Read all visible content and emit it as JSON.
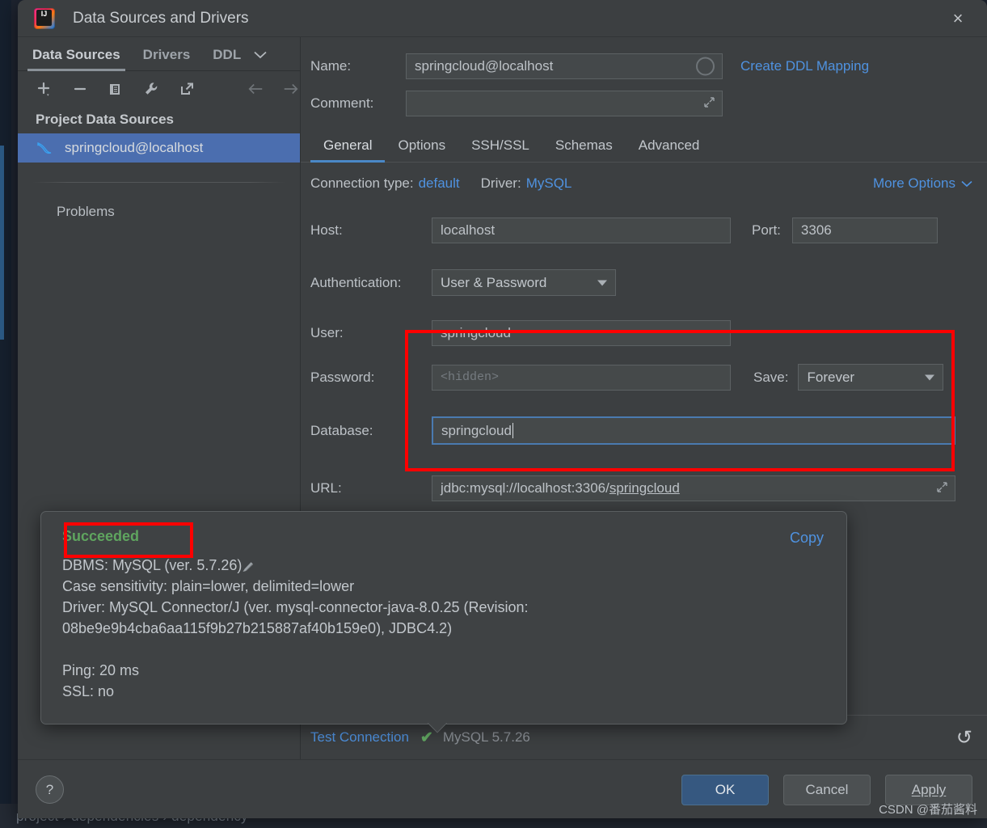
{
  "background": {
    "breadcrumb": "project  ›  dependencies  ›  dependency"
  },
  "window": {
    "title": "Data Sources and Drivers",
    "logo_text": "IJ",
    "close_icon": "×"
  },
  "left_pane": {
    "tabs": [
      {
        "label": "Data Sources",
        "active": true
      },
      {
        "label": "Drivers",
        "active": false
      },
      {
        "label": "DDL",
        "active": false
      }
    ],
    "tabs_overflow_icon": "chevron-down",
    "toolbar": [
      {
        "name": "add-data-source-button",
        "icon": "plus-dropdown"
      },
      {
        "name": "remove-data-source-button",
        "icon": "minus"
      },
      {
        "name": "duplicate-data-source-button",
        "icon": "copy"
      },
      {
        "name": "properties-button",
        "icon": "wrench"
      },
      {
        "name": "share-export-button",
        "icon": "external-link"
      },
      {
        "name": "navigate-back-button",
        "icon": "arrow-left"
      },
      {
        "name": "navigate-forward-button",
        "icon": "arrow-right"
      }
    ],
    "section_title": "Project Data Sources",
    "data_sources": [
      {
        "label": "springcloud@localhost",
        "icon": "mysql-dolphin-icon",
        "selected": true
      }
    ],
    "problems_label": "Problems"
  },
  "form": {
    "name_label": "Name:",
    "name_value": "springcloud@localhost",
    "comment_label": "Comment:",
    "comment_value": "",
    "create_ddl_mapping_label": "Create DDL Mapping"
  },
  "tabs": [
    {
      "label": "General",
      "active": true
    },
    {
      "label": "Options",
      "active": false
    },
    {
      "label": "SSH/SSL",
      "active": false
    },
    {
      "label": "Schemas",
      "active": false
    },
    {
      "label": "Advanced",
      "active": false
    }
  ],
  "connection": {
    "connection_type_label": "Connection type:",
    "connection_type_value": "default",
    "driver_label": "Driver:",
    "driver_value": "MySQL",
    "more_options_label": "More Options",
    "host_label": "Host:",
    "host_value": "localhost",
    "port_label": "Port:",
    "port_value": "3306",
    "auth_label": "Authentication:",
    "auth_value": "User & Password",
    "user_label": "User:",
    "user_value": "springcloud",
    "password_label": "Password:",
    "password_placeholder": "<hidden>",
    "save_label": "Save:",
    "save_value": "Forever",
    "database_label": "Database:",
    "database_value": "springcloud",
    "url_label": "URL:",
    "url_value_prefix": "jdbc:mysql://localhost:3306/",
    "url_value_suffix": "springcloud"
  },
  "popup": {
    "status": "Succeeded",
    "copy_label": "Copy",
    "lines": [
      "DBMS: MySQL (ver. 5.7.26)",
      "Case sensitivity: plain=lower, delimited=lower",
      "Driver: MySQL Connector/J (ver. mysql-connector-java-8.0.25 (Revision:",
      "08be9e9b4cba6aa115f9b27b215887af40b159e0), JDBC4.2)",
      "",
      "Ping: 20 ms",
      "SSL: no"
    ]
  },
  "test_bar": {
    "test_connection_label": "Test Connection",
    "check_icon": "✔",
    "driver_version": "MySQL 5.7.26",
    "revert_icon": "↺"
  },
  "footer": {
    "help_label": "?",
    "ok_label": "OK",
    "cancel_label": "Cancel",
    "apply_label": "Apply",
    "watermark": "CSDN @番茄酱料"
  },
  "colors": {
    "accent_blue": "#4f92e0",
    "selection_blue": "#4b6eaf",
    "primary_button": "#365880",
    "success_green": "#5fa55f",
    "annotation_red": "#ff0000",
    "window_bg": "#3c3f41"
  }
}
